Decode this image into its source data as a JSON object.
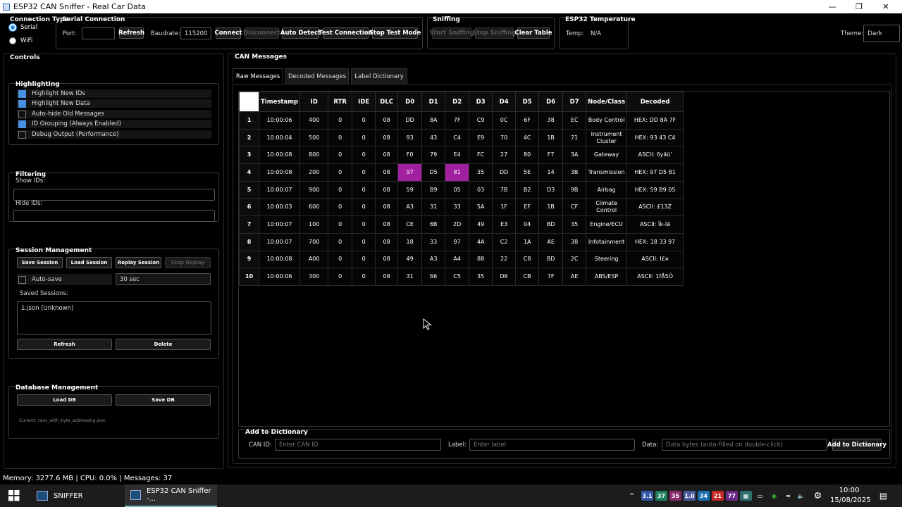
{
  "window": {
    "title": "ESP32 CAN Sniffer - Real Car Data"
  },
  "connection_type": {
    "title": "Connection Type",
    "serial": "Serial",
    "wifi": "WiFi"
  },
  "serial": {
    "title": "Serial Connection",
    "port_label": "Port:",
    "port_value": "",
    "refresh": "Refresh",
    "baud_label": "Baudrate:",
    "baud_value": "115200",
    "connect": "Connect",
    "disconnect": "Disconnect",
    "auto_detect": "Auto Detect",
    "test_connection": "Test Connection",
    "stop_test": "Stop Test Mode"
  },
  "sniffing": {
    "title": "Sniffing",
    "start": "Start Sniffing",
    "stop": "Stop Sniffing",
    "clear": "Clear Table"
  },
  "temperature": {
    "title": "ESP32 Temperature",
    "label": "Temp:",
    "value": "N/A"
  },
  "theme": {
    "label": "Theme:",
    "value": "Dark"
  },
  "controls": {
    "title": "Controls",
    "highlighting": {
      "title": "Highlighting",
      "items": [
        {
          "label": "Highlight New IDs",
          "checked": true
        },
        {
          "label": "Highlight New Data",
          "checked": true
        },
        {
          "label": "Auto-hide Old Messages",
          "checked": false
        },
        {
          "label": "ID Grouping (Always Enabled)",
          "checked": true
        },
        {
          "label": "Debug Output (Performance)",
          "checked": false
        }
      ]
    },
    "filtering": {
      "title": "Filtering",
      "show_ids": "Show IDs:",
      "hide_ids": "Hide IDs:"
    },
    "session": {
      "title": "Session Management",
      "save": "Save Session",
      "load": "Load Session",
      "replay": "Replay Session",
      "stop_replay": "Stop Replay",
      "autosave": "Auto-save",
      "interval": "30 sec",
      "saved_label": "Saved Sessions:",
      "saved_items": [
        "1.json (Unknown)"
      ],
      "refresh": "Refresh",
      "delete": "Delete"
    },
    "database": {
      "title": "Database Management",
      "load": "Load DB",
      "save": "Save DB",
      "current": "Current: canc_with_byte_addressing.json"
    }
  },
  "can": {
    "title": "CAN Messages",
    "tabs": [
      "Raw Messages",
      "Decoded Messages",
      "Label Dictionary"
    ],
    "columns": [
      "",
      "Timestamp",
      "ID",
      "RTR",
      "IDE",
      "DLC",
      "D0",
      "D1",
      "D2",
      "D3",
      "D4",
      "D5",
      "D6",
      "D7",
      "Node/Class",
      "Decoded"
    ],
    "rows": [
      [
        "1",
        "10:00:06",
        "400",
        "0",
        "0",
        "08",
        "DD",
        "8A",
        "7F",
        "C9",
        "0C",
        "6F",
        "38",
        "EC",
        "Body Control",
        "HEX: DD 8A 7F"
      ],
      [
        "2",
        "10:00:04",
        "500",
        "0",
        "0",
        "08",
        "93",
        "43",
        "C4",
        "E9",
        "70",
        "4C",
        "1B",
        "71",
        "Instrument Cluster",
        "HEX: 93 43 C4"
      ],
      [
        "3",
        "10:00:08",
        "800",
        "0",
        "0",
        "08",
        "F0",
        "79",
        "E4",
        "FC",
        "27",
        "80",
        "F7",
        "3A",
        "Gateway",
        "ASCII: ðyäü'"
      ],
      [
        "4",
        "10:00:08",
        "200",
        "0",
        "0",
        "08",
        "97",
        "D5",
        "81",
        "35",
        "DD",
        "5E",
        "14",
        "3B",
        "Transmission",
        "HEX: 97 D5 81"
      ],
      [
        "5",
        "10:00:07",
        "900",
        "0",
        "0",
        "08",
        "59",
        "B9",
        "05",
        "03",
        "7B",
        "B2",
        "D3",
        "9B",
        "Airbag",
        "HEX: 59 B9 05"
      ],
      [
        "6",
        "10:00:03",
        "600",
        "0",
        "0",
        "08",
        "A3",
        "31",
        "33",
        "5A",
        "1F",
        "EF",
        "1B",
        "CF",
        "Climate Control",
        "ASCII: £13Z"
      ],
      [
        "7",
        "10:00:07",
        "100",
        "0",
        "0",
        "08",
        "CE",
        "6B",
        "2D",
        "49",
        "E3",
        "04",
        "BD",
        "35",
        "Engine/ECU",
        "ASCII: Îk-Iã"
      ],
      [
        "8",
        "10:00:07",
        "700",
        "0",
        "0",
        "08",
        "18",
        "33",
        "97",
        "4A",
        "C2",
        "1A",
        "AE",
        "38",
        "Infotainment",
        "HEX: 18 33 97"
      ],
      [
        "9",
        "10:00:08",
        "A00",
        "0",
        "0",
        "08",
        "49",
        "A3",
        "A4",
        "88",
        "22",
        "C8",
        "BD",
        "2C",
        "Steering",
        "ASCII: I£¤"
      ],
      [
        "10",
        "10:00:06",
        "300",
        "0",
        "0",
        "08",
        "31",
        "66",
        "C5",
        "35",
        "D6",
        "CB",
        "7F",
        "AE",
        "ABS/ESP",
        "ASCII: 1fÅ5Ö"
      ]
    ],
    "highlight_color": "#a020a0",
    "highlights": [
      [
        3,
        6
      ],
      [
        3,
        8
      ]
    ]
  },
  "dictionary": {
    "title": "Add to Dictionary",
    "can_id_label": "CAN ID:",
    "can_id_placeholder": "Enter CAN ID",
    "label_label": "Label:",
    "label_placeholder": "Enter label",
    "data_label": "Data:",
    "data_placeholder": "Data bytes (auto-filled on double-click)",
    "add": "Add to Dictionary"
  },
  "status": "Memory: 3277.6 MB | CPU: 0.0% | Messages: 37",
  "taskbar": {
    "apps": [
      "SNIFFER",
      "ESP32 CAN Sniffer -..."
    ],
    "tray": [
      "3.1",
      "37",
      "35",
      "1.0",
      "34",
      "21",
      "77"
    ],
    "time": "10:00",
    "date": "15/08/2025"
  }
}
